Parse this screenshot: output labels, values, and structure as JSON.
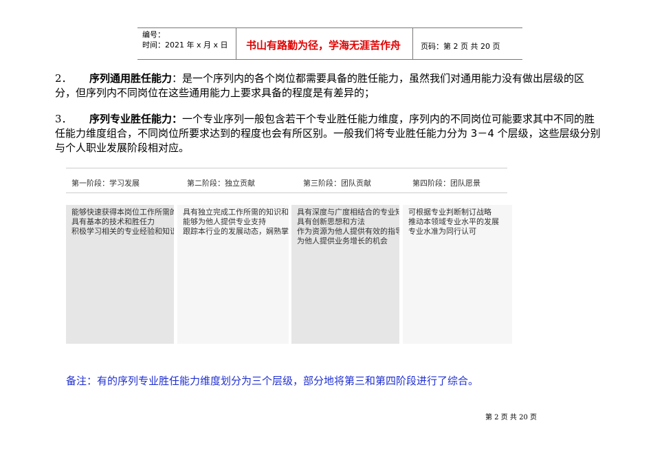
{
  "header": {
    "number_label": "编号：",
    "time_label": "时间：2021 年 x 月 x 日",
    "motto": "书山有路勤为径，学海无涯苦作舟",
    "page_info": "页码：第 2 页  共 20 页"
  },
  "paragraphs": [
    {
      "num": "2．",
      "bold": "序列通用胜任能力",
      "text": "：是一个序列内的各个岗位都需要具备的胜任能力，虽然我们对通用能力没有做出层级的区分，但序列内不同岗位在这些通用能力上要求具备的程度是有差异的；"
    },
    {
      "num": "3．",
      "bold": "序列专业胜任能力：",
      "text": "一个专业序列一般包含若干个专业胜任能力维度，序列内的不同岗位可能要求其中不同的胜任能力维度组合，不同岗位所要求达到的程度也会有所区别。一般我们将专业胜任能力分为 3－4 个层级，这些层级分别与个人职业发展阶段相对应。"
    }
  ],
  "stages": [
    {
      "label": "第一阶段：学习发展",
      "lines": [
        "能够快速获得本岗位工作所需的",
        "具有基本的技术和胜任力",
        "积极学习相关的专业经验和知识"
      ]
    },
    {
      "label": "第二阶段：独立贡献",
      "lines": [
        "具有独立完成工作所需的知识和",
        "能够为他人提供专业支持",
        "跟踪本行业的发展动态，娴熟掌"
      ]
    },
    {
      "label": "第三阶段：团队贡献",
      "lines": [
        "具有深度与广度相结合的专业知",
        "具有创新思想和方法",
        "作为资源为他人提供有效的指导",
        "为他人提供业务增长的机会"
      ]
    },
    {
      "label": "第四阶段：团队愿景",
      "lines": [
        "可根据专业判断制订战略",
        "推动本领域专业水平的发展",
        "专业水准为同行认可"
      ]
    }
  ],
  "note": "备注：有的序列专业胜任能力维度划分为三个层级，部分地将第三和第四阶段进行了综合。",
  "footer": "第 2 页 共 20 页"
}
